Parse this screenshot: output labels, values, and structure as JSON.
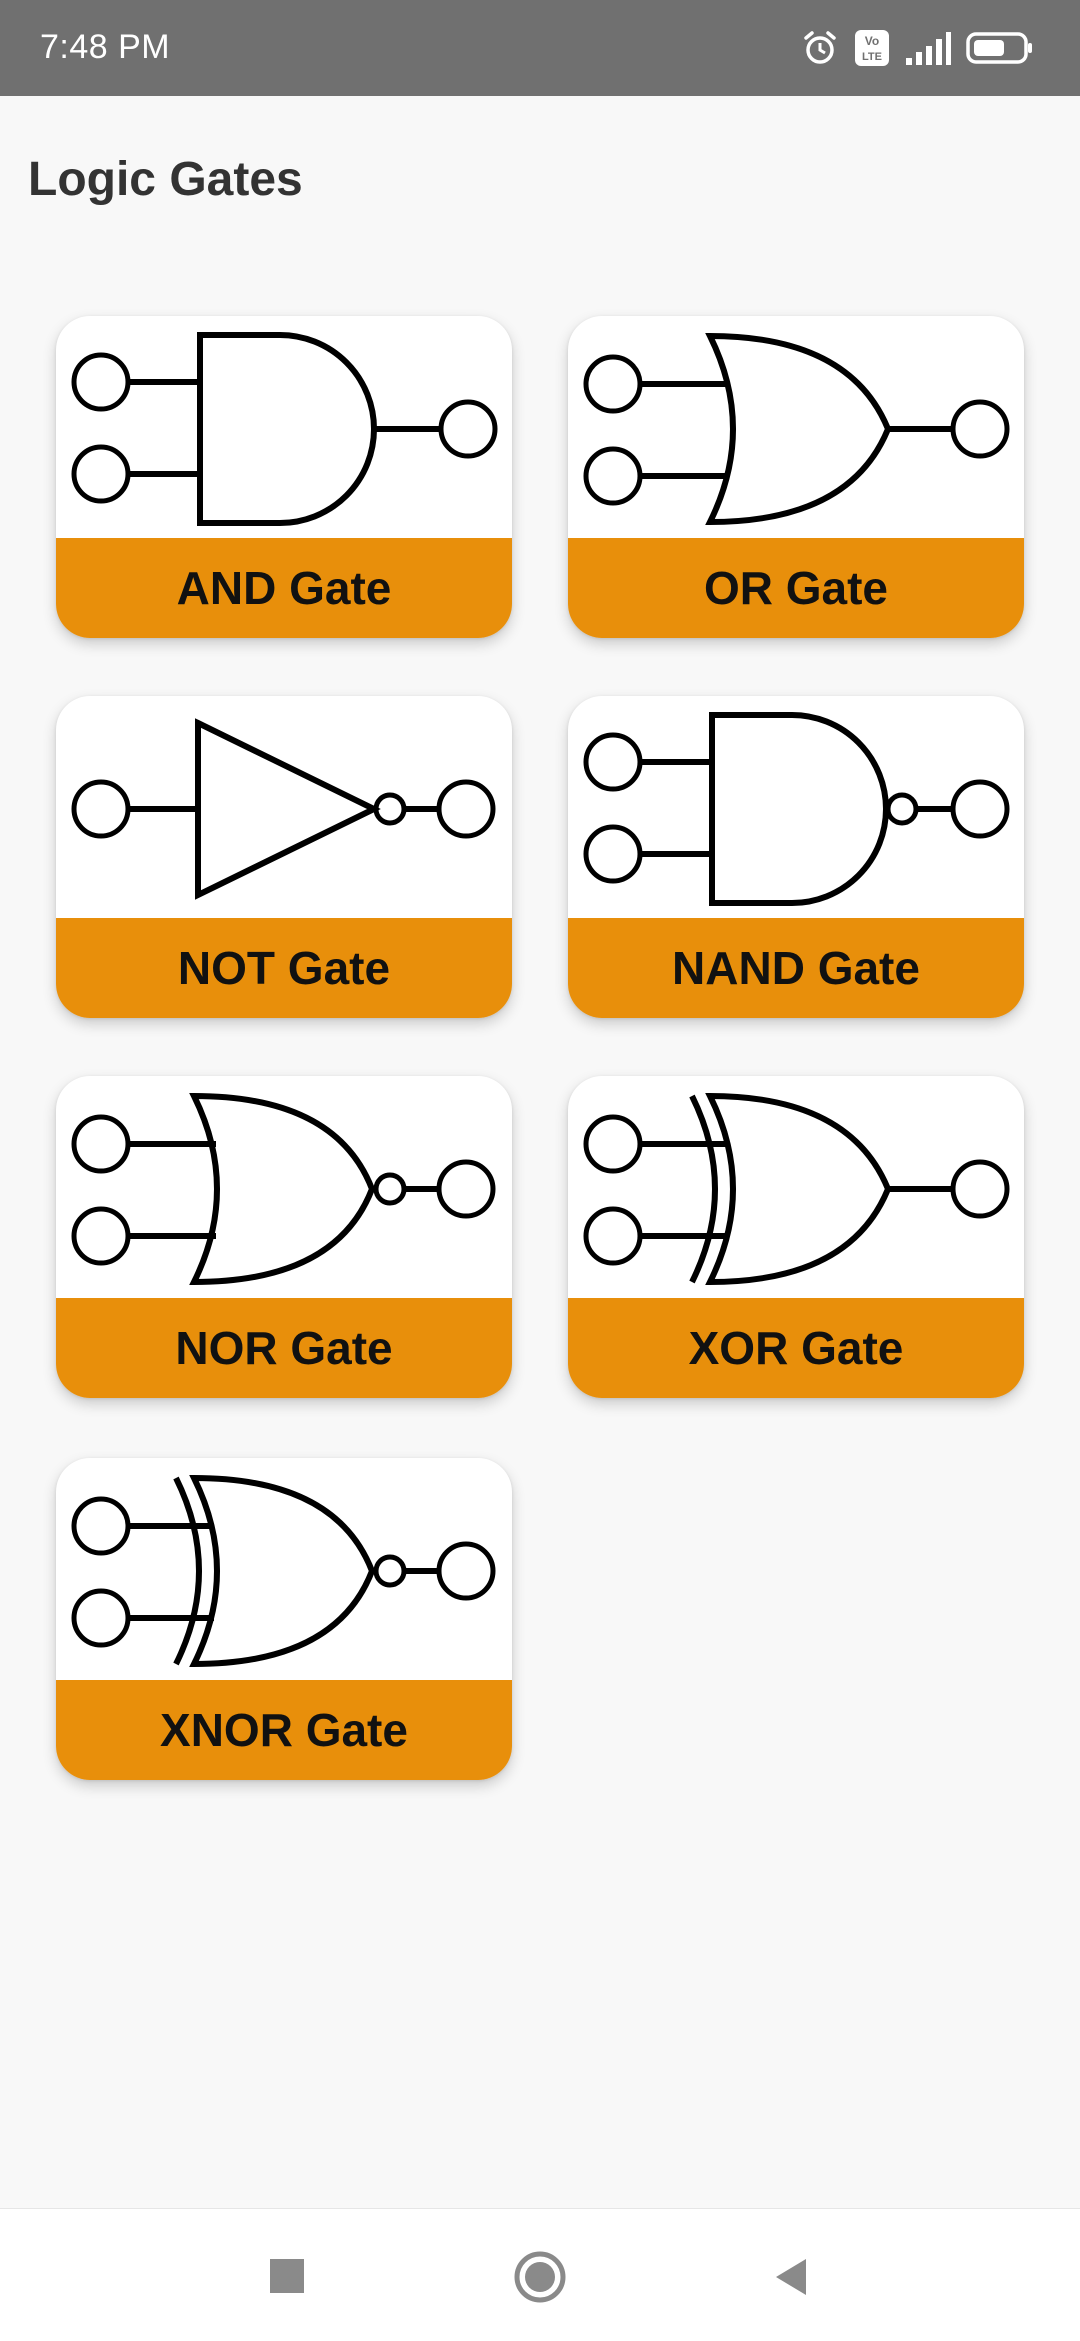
{
  "status_bar": {
    "time": "7:48 PM",
    "icons": [
      "alarm-icon",
      "volte-icon",
      "signal-icon",
      "battery-icon"
    ],
    "volte_text": "Vo LTE",
    "background": "#707070"
  },
  "page": {
    "title": "Logic Gates"
  },
  "gates": [
    {
      "label": "AND Gate",
      "symbol": "and-gate-icon"
    },
    {
      "label": "OR Gate",
      "symbol": "or-gate-icon"
    },
    {
      "label": "NOT Gate",
      "symbol": "not-gate-icon"
    },
    {
      "label": "NAND Gate",
      "symbol": "nand-gate-icon"
    },
    {
      "label": "NOR Gate",
      "symbol": "nor-gate-icon"
    },
    {
      "label": "XOR Gate",
      "symbol": "xor-gate-icon"
    },
    {
      "label": "XNOR Gate",
      "symbol": "xnor-gate-icon"
    }
  ],
  "nav_bar": {
    "buttons": [
      "recent-apps-icon",
      "home-icon",
      "back-icon"
    ]
  },
  "colors": {
    "accent": "#e88f0b",
    "card_background": "#ffffff",
    "page_background": "#f8f8f8"
  }
}
